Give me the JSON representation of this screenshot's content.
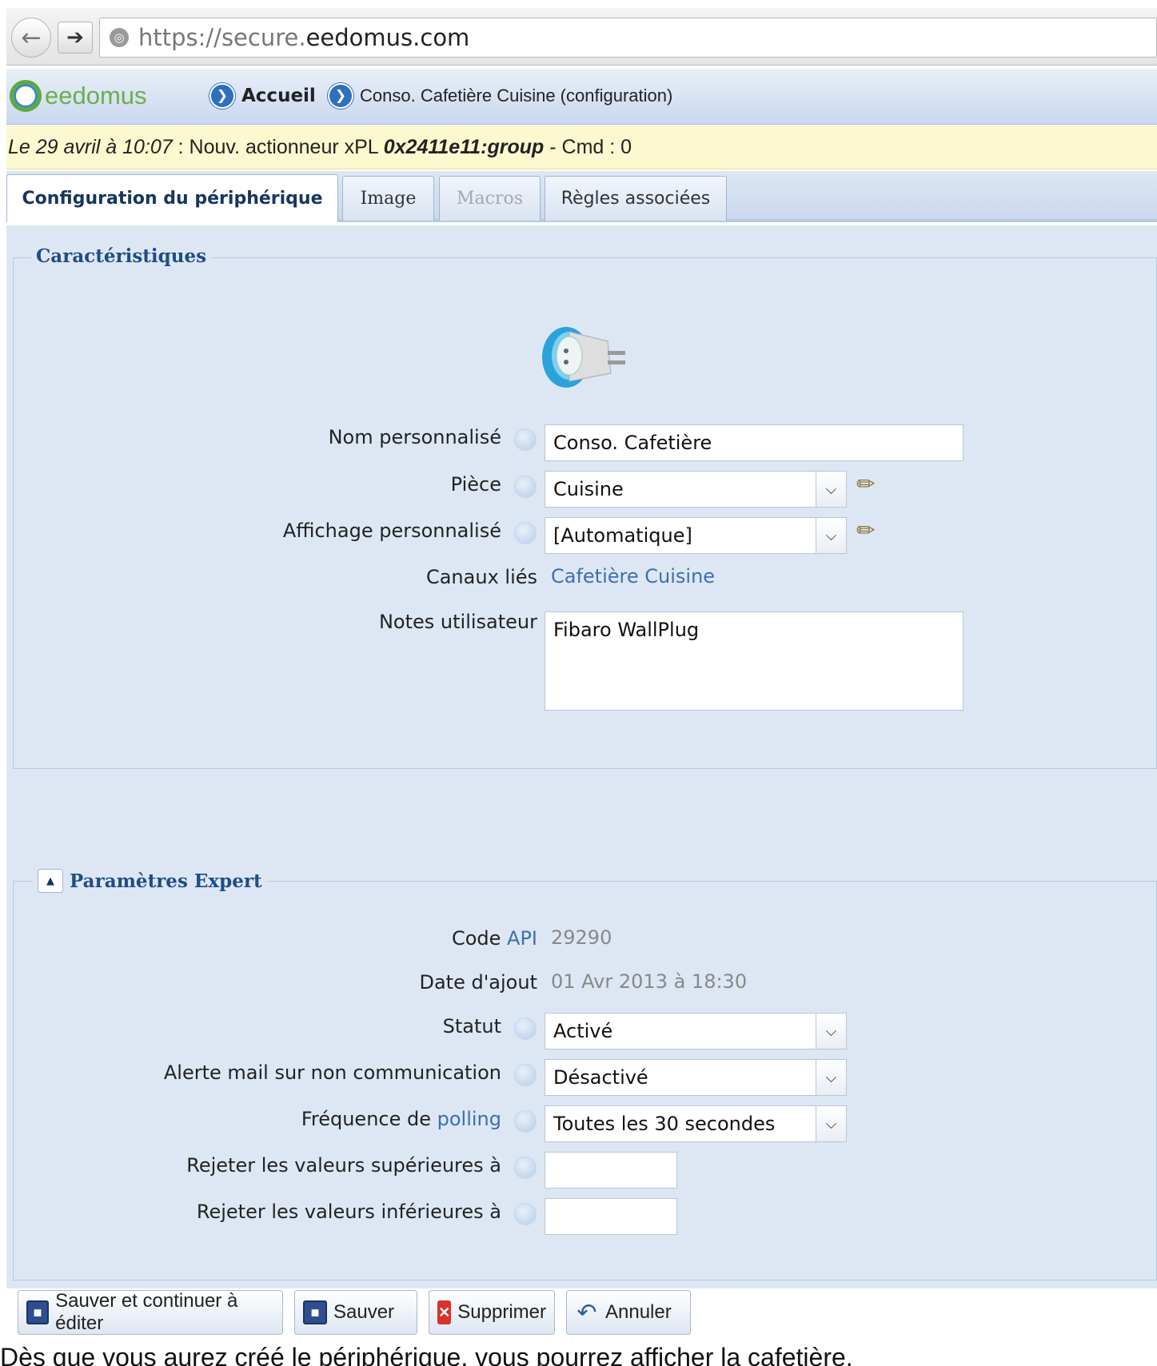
{
  "browser": {
    "url_prefix": "https://secure.",
    "url_domain": "eedomus.com"
  },
  "header": {
    "logo_text": "eedomus",
    "breadcrumb_home": "Accueil",
    "breadcrumb_device": "Conso. Cafetière Cuisine (configuration)"
  },
  "notification": {
    "date": "Le 29 avril à 10:07",
    "message": " : Nouv. actionneur xPL ",
    "address": "0x2411e11:group",
    "suffix": " - Cmd : 0"
  },
  "tabs": [
    {
      "label": "Configuration du périphérique"
    },
    {
      "label": "Image"
    },
    {
      "label": "Macros"
    },
    {
      "label": "Règles associées"
    }
  ],
  "characteristics": {
    "legend": "Caractéristiques",
    "name_label": "Nom personnalisé",
    "name_value": "Conso. Cafetière",
    "room_label": "Pièce",
    "room_value": "Cuisine",
    "display_label": "Affichage personnalisé",
    "display_value": "[Automatique]",
    "channels_label": "Canaux liés",
    "channels_value": "Cafetière Cuisine",
    "notes_label": "Notes utilisateur",
    "notes_value": "Fibaro WallPlug"
  },
  "expert": {
    "legend": "Paramètres Expert",
    "code_label_prefix": "Code ",
    "code_label_link": "API",
    "code_value": "29290",
    "date_label": "Date d'ajout",
    "date_value": "01 Avr 2013 à 18:30",
    "status_label": "Statut",
    "status_value": "Activé",
    "alert_label": "Alerte mail sur non communication",
    "alert_value": "Désactivé",
    "polling_label_prefix": "Fréquence de ",
    "polling_label_link": "polling",
    "polling_value": "Toutes les 30 secondes",
    "reject_above_label": "Rejeter les valeurs supérieures à",
    "reject_above_value": "",
    "reject_below_label": "Rejeter les valeurs inférieures à",
    "reject_below_value": ""
  },
  "buttons": {
    "save_continue": "Sauver et continuer à éditer",
    "save": "Sauver",
    "delete": "Supprimer",
    "cancel": "Annuler"
  },
  "footer_text": "Dès que vous aurez créé le périphérique, vous pourrez afficher la cafetière."
}
